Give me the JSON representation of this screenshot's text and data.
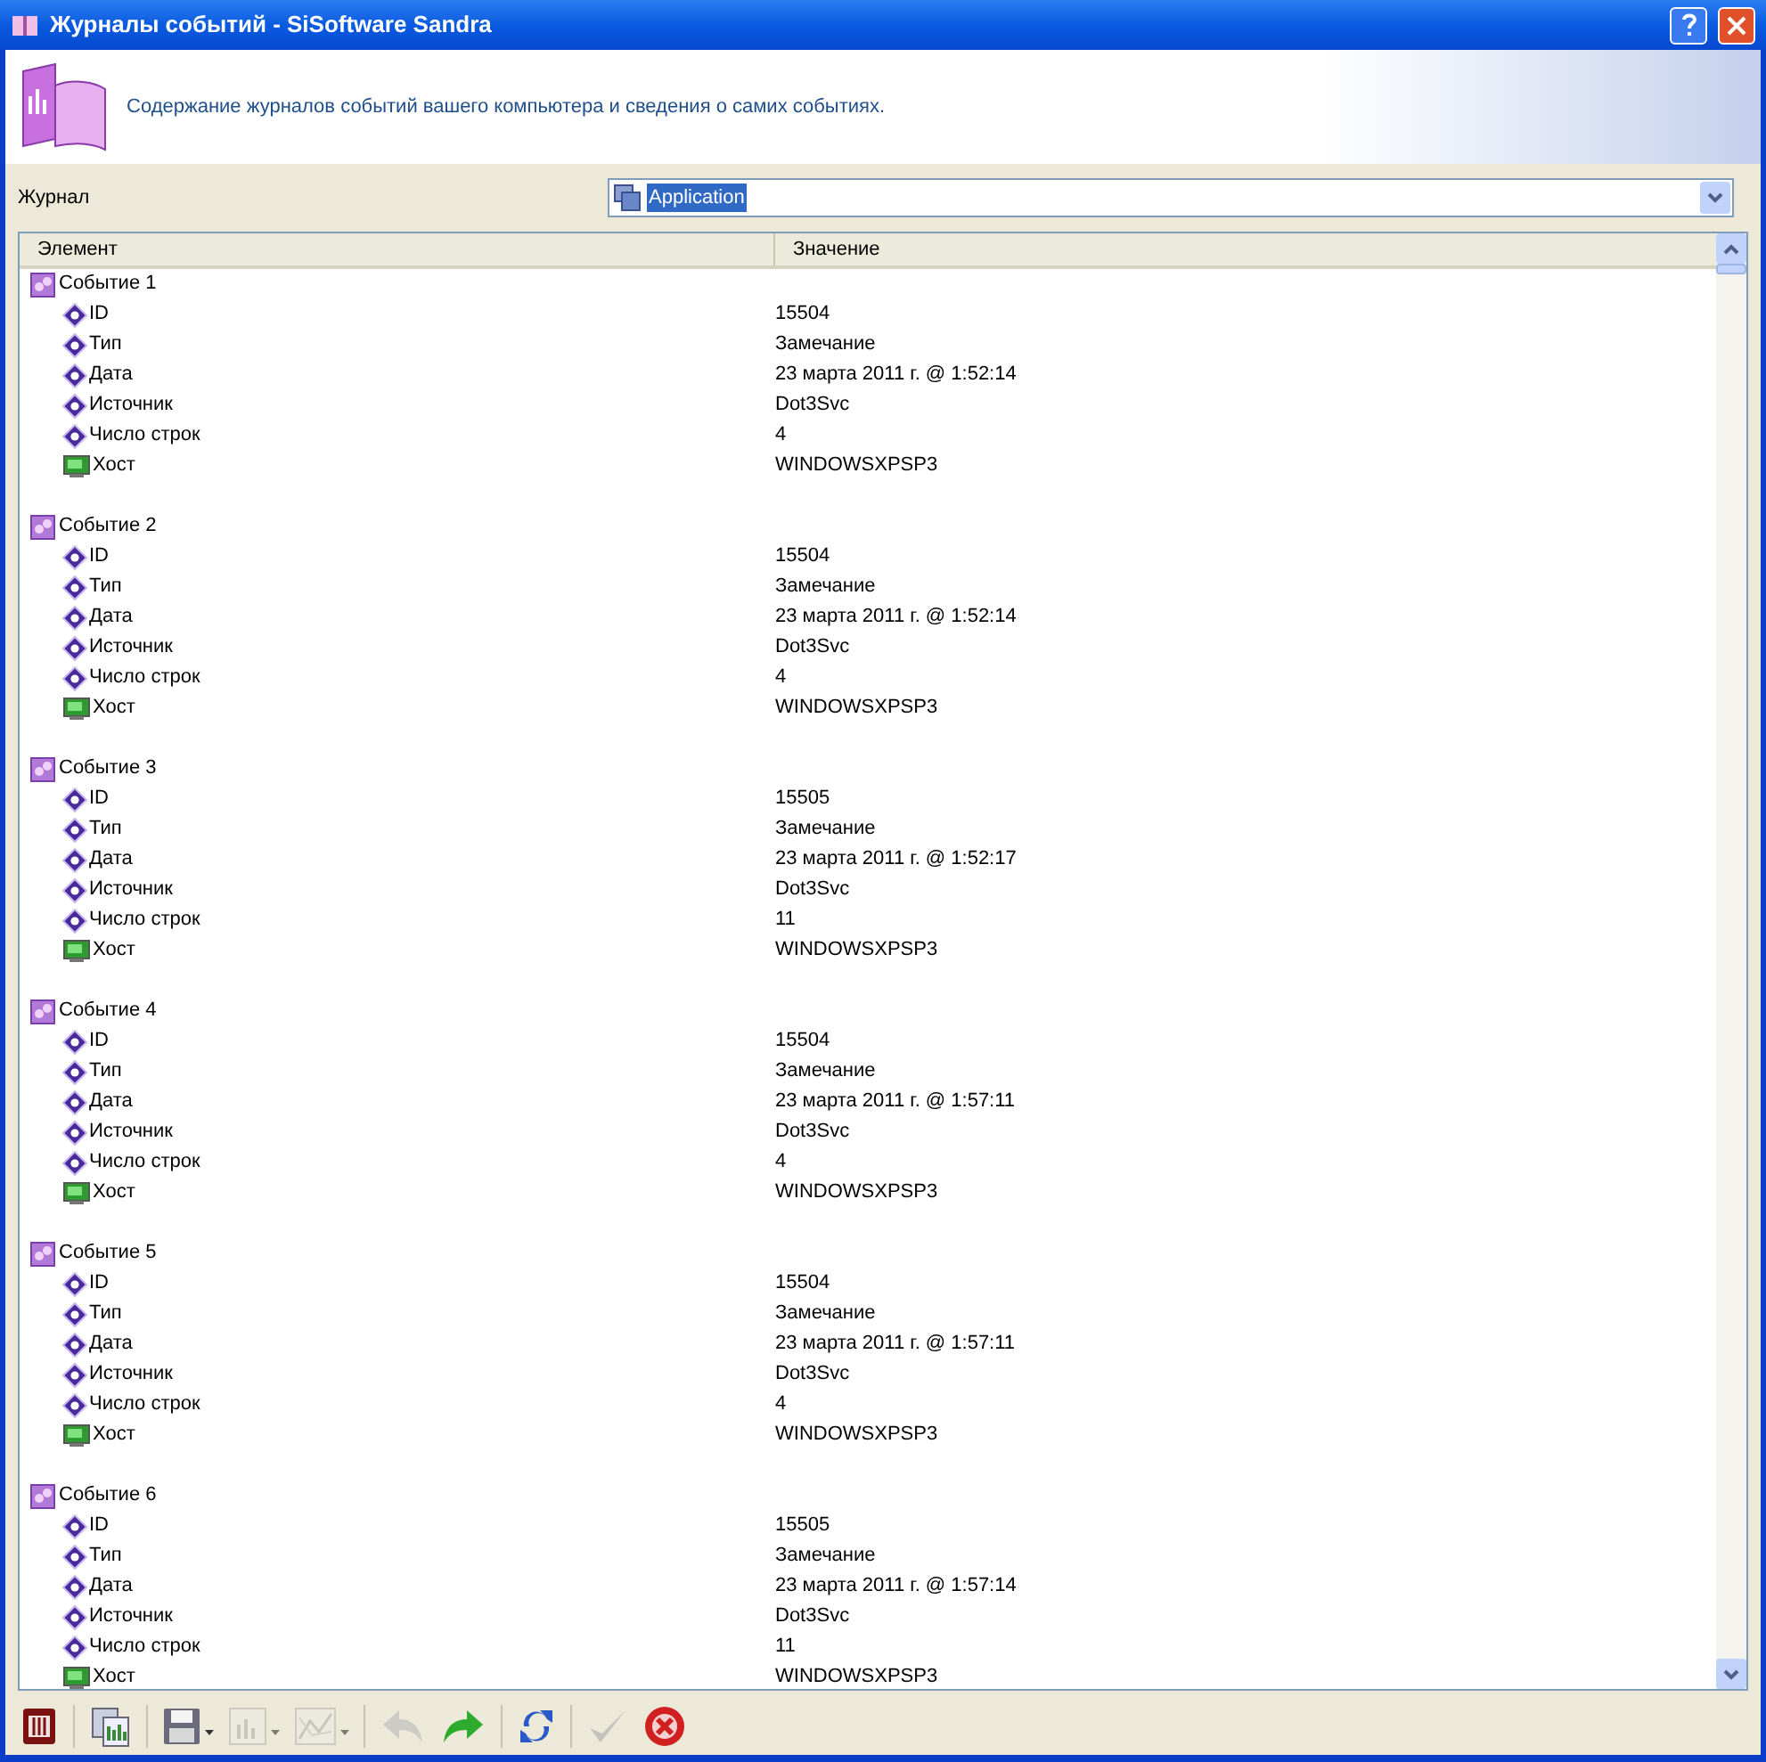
{
  "window": {
    "title": "Журналы событий - SiSoftware Sandra"
  },
  "header": {
    "description": "Содержание журналов событий вашего компьютера и сведения о самих событиях."
  },
  "log_selector": {
    "label": "Журнал",
    "value": "Application"
  },
  "columns": [
    "Элемент",
    "Значение"
  ],
  "events": [
    {
      "title": "Событие 1",
      "fields": [
        {
          "kind": "property",
          "name": "ID",
          "value": "15504"
        },
        {
          "kind": "property",
          "name": "Тип",
          "value": "Замечание"
        },
        {
          "kind": "property",
          "name": "Дата",
          "value": "23 марта 2011 г. @ 1:52:14"
        },
        {
          "kind": "property",
          "name": "Источник",
          "value": "Dot3Svc"
        },
        {
          "kind": "property",
          "name": "Число строк",
          "value": "4"
        },
        {
          "kind": "host",
          "name": "Хост",
          "value": "WINDOWSXPSP3"
        }
      ]
    },
    {
      "title": "Событие 2",
      "fields": [
        {
          "kind": "property",
          "name": "ID",
          "value": "15504"
        },
        {
          "kind": "property",
          "name": "Тип",
          "value": "Замечание"
        },
        {
          "kind": "property",
          "name": "Дата",
          "value": "23 марта 2011 г. @ 1:52:14"
        },
        {
          "kind": "property",
          "name": "Источник",
          "value": "Dot3Svc"
        },
        {
          "kind": "property",
          "name": "Число строк",
          "value": "4"
        },
        {
          "kind": "host",
          "name": "Хост",
          "value": "WINDOWSXPSP3"
        }
      ]
    },
    {
      "title": "Событие 3",
      "fields": [
        {
          "kind": "property",
          "name": "ID",
          "value": "15505"
        },
        {
          "kind": "property",
          "name": "Тип",
          "value": "Замечание"
        },
        {
          "kind": "property",
          "name": "Дата",
          "value": "23 марта 2011 г. @ 1:52:17"
        },
        {
          "kind": "property",
          "name": "Источник",
          "value": "Dot3Svc"
        },
        {
          "kind": "property",
          "name": "Число строк",
          "value": "11"
        },
        {
          "kind": "host",
          "name": "Хост",
          "value": "WINDOWSXPSP3"
        }
      ]
    },
    {
      "title": "Событие 4",
      "fields": [
        {
          "kind": "property",
          "name": "ID",
          "value": "15504"
        },
        {
          "kind": "property",
          "name": "Тип",
          "value": "Замечание"
        },
        {
          "kind": "property",
          "name": "Дата",
          "value": "23 марта 2011 г. @ 1:57:11"
        },
        {
          "kind": "property",
          "name": "Источник",
          "value": "Dot3Svc"
        },
        {
          "kind": "property",
          "name": "Число строк",
          "value": "4"
        },
        {
          "kind": "host",
          "name": "Хост",
          "value": "WINDOWSXPSP3"
        }
      ]
    },
    {
      "title": "Событие 5",
      "fields": [
        {
          "kind": "property",
          "name": "ID",
          "value": "15504"
        },
        {
          "kind": "property",
          "name": "Тип",
          "value": "Замечание"
        },
        {
          "kind": "property",
          "name": "Дата",
          "value": "23 марта 2011 г. @ 1:57:11"
        },
        {
          "kind": "property",
          "name": "Источник",
          "value": "Dot3Svc"
        },
        {
          "kind": "property",
          "name": "Число строк",
          "value": "4"
        },
        {
          "kind": "host",
          "name": "Хост",
          "value": "WINDOWSXPSP3"
        }
      ]
    },
    {
      "title": "Событие 6",
      "fields": [
        {
          "kind": "property",
          "name": "ID",
          "value": "15505"
        },
        {
          "kind": "property",
          "name": "Тип",
          "value": "Замечание"
        },
        {
          "kind": "property",
          "name": "Дата",
          "value": "23 марта 2011 г. @ 1:57:14"
        },
        {
          "kind": "property",
          "name": "Источник",
          "value": "Dot3Svc"
        },
        {
          "kind": "property",
          "name": "Число строк",
          "value": "11"
        },
        {
          "kind": "host",
          "name": "Хост",
          "value": "WINDOWSXPSP3"
        }
      ]
    }
  ],
  "toolbar": [
    {
      "kind": "device",
      "disabled": false,
      "has_menu": false
    },
    {
      "kind": "report",
      "disabled": false,
      "has_menu": false
    },
    {
      "kind": "save",
      "disabled": false,
      "has_menu": true
    },
    {
      "kind": "bar-chart",
      "disabled": true,
      "has_menu": true
    },
    {
      "kind": "line-chart",
      "disabled": true,
      "has_menu": true
    },
    {
      "kind": "back",
      "disabled": true,
      "has_menu": false
    },
    {
      "kind": "forward",
      "disabled": false,
      "has_menu": false
    },
    {
      "kind": "refresh",
      "disabled": false,
      "has_menu": false
    },
    {
      "kind": "ok",
      "disabled": true,
      "has_menu": false
    },
    {
      "kind": "cancel",
      "disabled": false,
      "has_menu": false
    }
  ]
}
